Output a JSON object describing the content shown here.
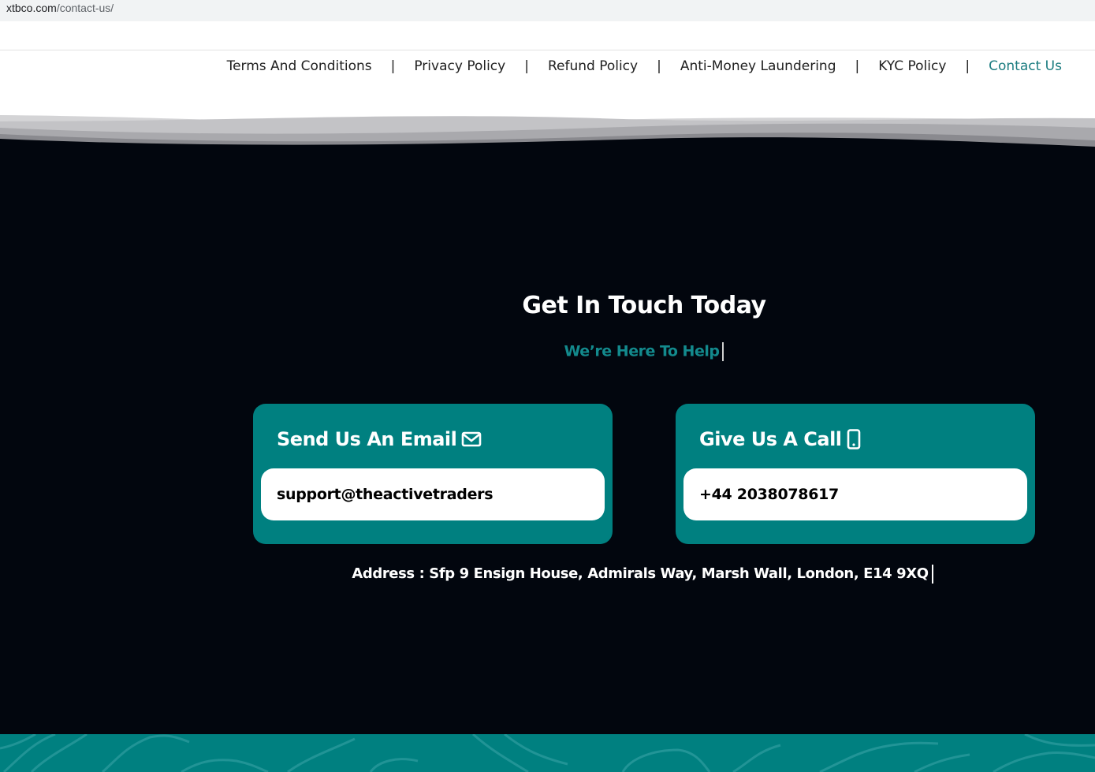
{
  "browser": {
    "url_host": "xtbco.com",
    "url_path": "/contact-us/"
  },
  "nav": {
    "items": [
      {
        "label": "Terms And Conditions"
      },
      {
        "label": "Privacy Policy"
      },
      {
        "label": "Refund Policy"
      },
      {
        "label": "Anti-Money Laundering"
      },
      {
        "label": "KYC Policy"
      },
      {
        "label": "Contact Us",
        "active": true
      }
    ],
    "separator": "|"
  },
  "hero": {
    "title": "Get In Touch Today",
    "subtitle": "We’re Here To Help"
  },
  "cards": {
    "email": {
      "title": "Send Us An Email",
      "icon": "envelope-icon",
      "value": "support@theactivetraders"
    },
    "call": {
      "title": "Give Us A Call",
      "icon": "mobile-phone-icon",
      "value": "+44 2038078617"
    }
  },
  "address": {
    "text": "Address : Sfp 9 Ensign House, Admirals Way, Marsh Wall, London, E14 9XQ"
  },
  "colors": {
    "teal": "#008080",
    "teal_text": "#138a8d",
    "dark_bg": "#02060e",
    "nav_active": "#1b7c80"
  }
}
